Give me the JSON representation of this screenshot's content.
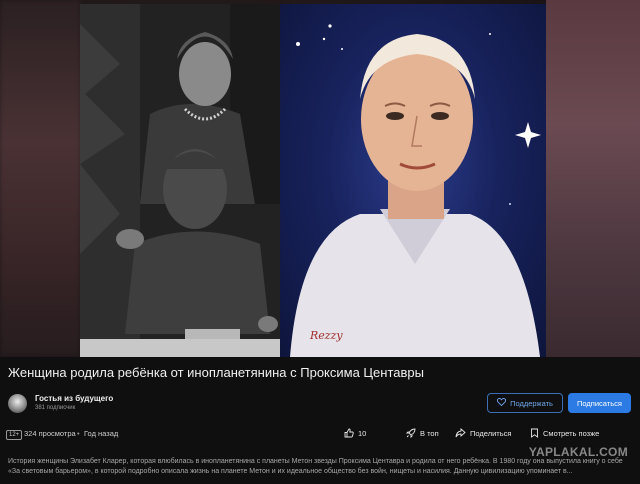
{
  "video": {
    "title": "Женщина родила ребёнка от инопланетянина с Проксима Центавры"
  },
  "channel": {
    "name": "Гостья из будущего",
    "subscribers": "381 подписчик",
    "support_label": "Поддержать",
    "subscribe_label": "Подписаться"
  },
  "stats": {
    "age_rating": "12+",
    "views": "324 просмотра",
    "separator": "•",
    "published": "Год назад",
    "likes": "10"
  },
  "actions": {
    "top_label": "В топ",
    "share_label": "Поделиться",
    "watch_later_label": "Смотреть позже"
  },
  "description": {
    "text": "История женщины Элизабет Кларер, которая влюбилась в инопланетянина с планеты Метон звезды Проксима Центавра и родила от него ребёнка. В 1980 году она выпустила книгу о себе «За световым барьером», в которой подробно описала жизнь на планете Метон и их идеальное общество без войн, нищеты и насилия. Данную цивилизацию упоминает в..."
  },
  "watermark": "YAPLAKAL.COM",
  "colors": {
    "background": "#0f0f10",
    "accent": "#2c7be5",
    "outline_button": "#3a6fb6"
  },
  "icons": {
    "support": "heart-icon",
    "like": "thumb-up-icon",
    "top": "rocket-icon",
    "share": "share-arrow-icon",
    "watch_later": "bookmark-icon"
  }
}
